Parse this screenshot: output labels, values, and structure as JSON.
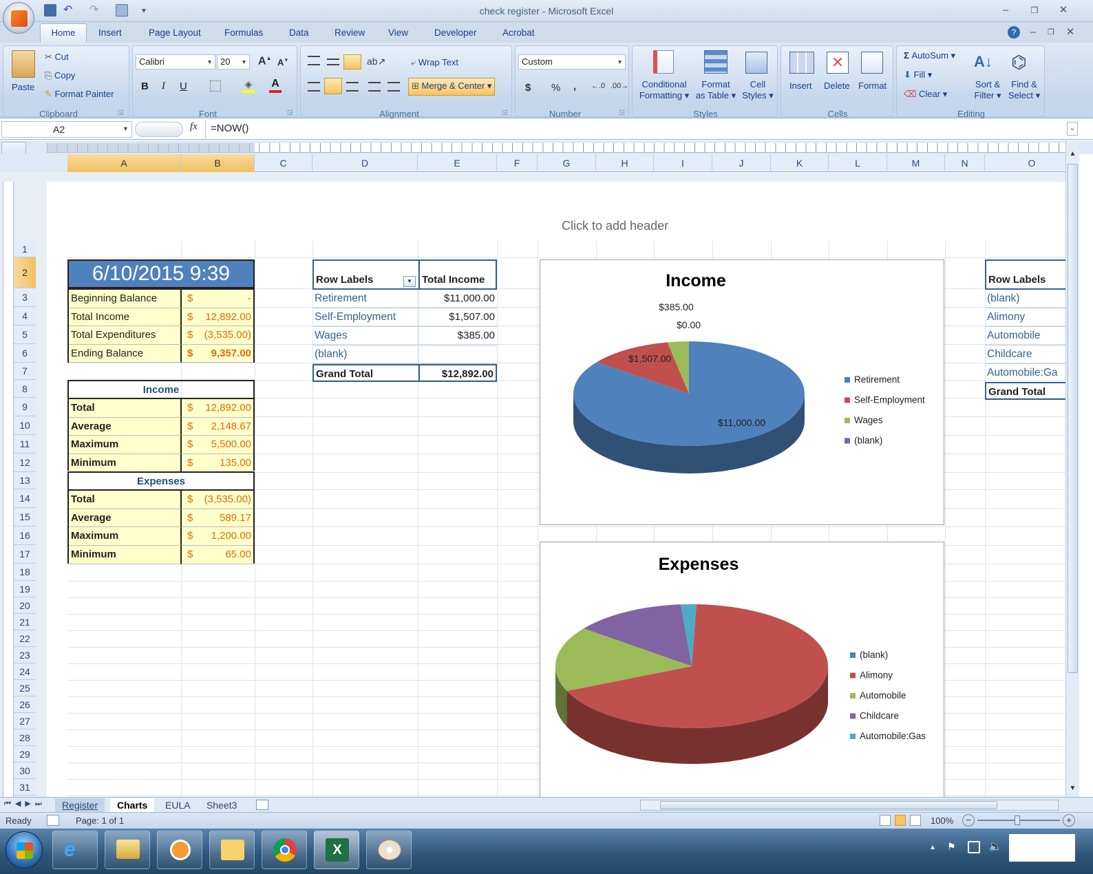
{
  "window": {
    "title": "check register - Microsoft Excel"
  },
  "tabs": [
    "Home",
    "Insert",
    "Page Layout",
    "Formulas",
    "Data",
    "Review",
    "View",
    "Developer",
    "Acrobat"
  ],
  "ribbon": {
    "clipboard": {
      "paste": "Paste",
      "cut": "Cut",
      "copy": "Copy",
      "format_painter": "Format Painter",
      "label": "Clipboard"
    },
    "font": {
      "name": "Calibri",
      "size": "20",
      "bold": "B",
      "italic": "I",
      "underline": "U",
      "label": "Font"
    },
    "alignment": {
      "wrap": "Wrap Text",
      "merge": "Merge & Center",
      "label": "Alignment"
    },
    "number": {
      "format": "Custom",
      "currency": "$",
      "percent": "%",
      "comma": ",",
      "label": "Number"
    },
    "styles": {
      "conditional_1": "Conditional",
      "conditional_2": "Formatting",
      "format_table_1": "Format",
      "format_table_2": "as Table",
      "cell_styles_1": "Cell",
      "cell_styles_2": "Styles",
      "label": "Styles"
    },
    "cells": {
      "insert": "Insert",
      "delete": "Delete",
      "format": "Format",
      "label": "Cells"
    },
    "editing": {
      "autosum": "AutoSum",
      "fill": "Fill",
      "clear": "Clear",
      "sort_1": "Sort &",
      "sort_2": "Filter",
      "find_1": "Find &",
      "find_2": "Select",
      "label": "Editing"
    }
  },
  "formula_bar": {
    "name_box": "A2",
    "fx": "fx",
    "formula": "=NOW()"
  },
  "columns": [
    "A",
    "B",
    "C",
    "D",
    "E",
    "F",
    "G",
    "H",
    "I",
    "J",
    "K",
    "L",
    "M",
    "N",
    "O"
  ],
  "rows": [
    "1",
    "2",
    "3",
    "4",
    "5",
    "6",
    "7",
    "8",
    "9",
    "10",
    "11",
    "12",
    "13",
    "14",
    "15",
    "16",
    "17",
    "18",
    "19",
    "20",
    "21",
    "22",
    "23",
    "24",
    "25",
    "26",
    "27",
    "28",
    "29",
    "30",
    "31"
  ],
  "header_placeholder": "Click to add header",
  "summary": {
    "date": "6/10/2015 9:39",
    "rows": [
      {
        "label": "Beginning Balance",
        "cur": "$",
        "value": "-"
      },
      {
        "label": "Total Income",
        "cur": "$",
        "value": "12,892.00"
      },
      {
        "label": "Total Expenditures",
        "cur": "$",
        "value": "(3,535.00)"
      },
      {
        "label": "Ending Balance",
        "cur": "$",
        "value": "9,357.00"
      }
    ],
    "income_header": "Income",
    "income": [
      {
        "label": "Total",
        "cur": "$",
        "value": "12,892.00"
      },
      {
        "label": "Average",
        "cur": "$",
        "value": "2,148.67"
      },
      {
        "label": "Maximum",
        "cur": "$",
        "value": "5,500.00"
      },
      {
        "label": "Minimum",
        "cur": "$",
        "value": "135.00"
      }
    ],
    "expenses_header": "Expenses",
    "expenses": [
      {
        "label": "Total",
        "cur": "$",
        "value": "(3,535.00)"
      },
      {
        "label": "Average",
        "cur": "$",
        "value": "589.17"
      },
      {
        "label": "Maximum",
        "cur": "$",
        "value": "1,200.00"
      },
      {
        "label": "Minimum",
        "cur": "$",
        "value": "65.00"
      }
    ]
  },
  "pivot_income": {
    "header_labels": "Row Labels",
    "header_total": "Total Income",
    "rows": [
      {
        "label": "Retirement",
        "value": "$11,000.00"
      },
      {
        "label": "Self-Employment",
        "value": "$1,507.00"
      },
      {
        "label": "Wages",
        "value": "$385.00"
      },
      {
        "label": "(blank)",
        "value": ""
      }
    ],
    "grand_label": "Grand Total",
    "grand_value": "$12,892.00"
  },
  "pivot_expenses": {
    "header_labels": "Row Labels",
    "rows": [
      "(blank)",
      "Alimony",
      "Automobile",
      "Childcare",
      "Automobile:Ga"
    ],
    "grand_label": "Grand Total"
  },
  "chart_data": [
    {
      "type": "pie",
      "title": "Income",
      "categories": [
        "Retirement",
        "Self-Employment",
        "Wages",
        "(blank)"
      ],
      "values": [
        11000,
        1507,
        385,
        0
      ],
      "data_labels": [
        "$11,000.00",
        "$1,507.00",
        "$385.00",
        "$0.00"
      ],
      "colors": [
        "#4f81bd",
        "#c0504d",
        "#9bbb59",
        "#8064a2"
      ],
      "legend": "right"
    },
    {
      "type": "pie",
      "title": "Expenses",
      "categories": [
        "(blank)",
        "Alimony",
        "Automobile",
        "Childcare",
        "Automobile:Gas"
      ],
      "values": [
        0,
        2400,
        600,
        470,
        65
      ],
      "colors": [
        "#4f81bd",
        "#c0504d",
        "#9bbb59",
        "#8064a2",
        "#4bacc6"
      ],
      "legend": "right"
    }
  ],
  "sheet_tabs": [
    "Register",
    "Charts",
    "EULA",
    "Sheet3"
  ],
  "status": {
    "ready": "Ready",
    "page": "Page: 1 of 1",
    "zoom": "100%"
  }
}
